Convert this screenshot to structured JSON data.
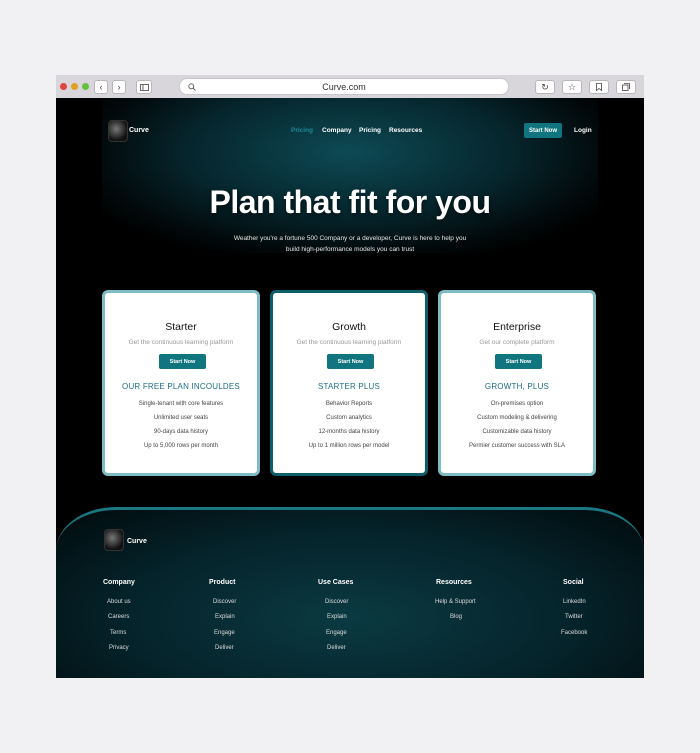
{
  "browser": {
    "url": "Curve.com"
  },
  "header": {
    "brand": "Curve",
    "nav": [
      "Pricing",
      "Company",
      "Pricing",
      "Resources"
    ],
    "cta": "Start Now",
    "login": "Login"
  },
  "hero": {
    "title": "Plan that fit for you",
    "subtitle_line1": "Weather you're a fortune 500 Company or a developer, Curve is here to help you",
    "subtitle_line2": "build high-performance models you can trust"
  },
  "plans": [
    {
      "name": "Starter",
      "description": "Get the continuous learning platform",
      "button": "Start Now",
      "tier": "OUR FREE PLAN INCOULDES",
      "features": [
        "Single-tenant with core features",
        "Unlimited user seats",
        "90-days data history",
        "Up to 5,000 rows per month"
      ]
    },
    {
      "name": "Growth",
      "description": "Get the continuous learning platform",
      "button": "Start Now",
      "tier": "STARTER PLUS",
      "features": [
        "Behavior Reports",
        "Custom analytics",
        "12-months data history",
        "Up to 1 million rows per model"
      ]
    },
    {
      "name": "Enterprise",
      "description": "Get our complete platform",
      "button": "Start Now",
      "tier": "GROWTH, PLUS",
      "features": [
        "On-premises option",
        "Custom modeling & delivering",
        "Customizable data history",
        "Permier customer success with SLA"
      ]
    }
  ],
  "footer": {
    "brand": "Curve",
    "columns": [
      {
        "title": "Company",
        "links": [
          "About us",
          "Careers",
          "Terms",
          "Privacy"
        ]
      },
      {
        "title": "Product",
        "links": [
          "Discover",
          "Explain",
          "Engage",
          "Deliver"
        ]
      },
      {
        "title": "Use Cases",
        "links": [
          "Discover",
          "Explain",
          "Engage",
          "Deliver"
        ]
      },
      {
        "title": "Resources",
        "links": [
          "Help & Support",
          "Blog"
        ]
      },
      {
        "title": "Social",
        "links": [
          "LinkedIn",
          "Twitter",
          "Facebook"
        ]
      }
    ]
  },
  "colors": {
    "accent": "#117580",
    "accent_light": "#1d8a96",
    "card_border": "#7fbcc4",
    "tier_text": "#1c6e86"
  }
}
